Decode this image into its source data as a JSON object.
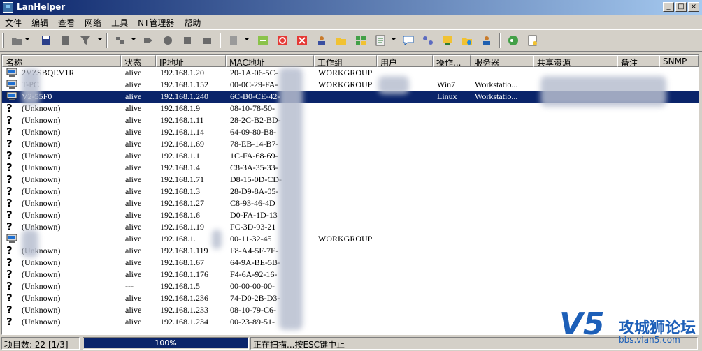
{
  "window": {
    "title": "LanHelper",
    "min": "_",
    "max": "□",
    "close": "×"
  },
  "menu": [
    "文件",
    "编辑",
    "查看",
    "网络",
    "工具",
    "NT管理器",
    "帮助"
  ],
  "columns": [
    "名称",
    "状态",
    "IP地址",
    "MAC地址",
    "工作组",
    "用户",
    "操作...",
    "服务器",
    "共享资源",
    "备注",
    "SNMP"
  ],
  "rows": [
    {
      "icon": "computer-icon",
      "name": "2VZSBQEV1R",
      "status": "alive",
      "ip": "192.168.1.20",
      "mac": "20-1A-06-5C-",
      "workgroup": "WORKGROUP",
      "user": "",
      "os": "",
      "server": "",
      "selected": false
    },
    {
      "icon": "computer-icon",
      "name": "T-PC",
      "status": "alive",
      "ip": "192.168.1.152",
      "mac": "00-0C-29-FA-",
      "workgroup": "WORKGROUP",
      "user": "",
      "os": "Win7",
      "server": "Workstatio...",
      "selected": false
    },
    {
      "icon": "computer-icon",
      "name": "V2-55F0",
      "status": "alive",
      "ip": "192.168.1.240",
      "mac": "6C-B0-CE-42-",
      "workgroup": "",
      "user": "",
      "os": "Linux",
      "server": "Workstatio...",
      "selected": true
    },
    {
      "icon": "unknown-icon",
      "name": "(Unknown)",
      "status": "alive",
      "ip": "192.168.1.9",
      "mac": "08-10-78-50-",
      "workgroup": "",
      "user": "",
      "os": "",
      "server": "",
      "selected": false
    },
    {
      "icon": "unknown-icon",
      "name": "(Unknown)",
      "status": "alive",
      "ip": "192.168.1.11",
      "mac": "28-2C-B2-BD-",
      "workgroup": "",
      "user": "",
      "os": "",
      "server": "",
      "selected": false
    },
    {
      "icon": "unknown-icon",
      "name": "(Unknown)",
      "status": "alive",
      "ip": "192.168.1.14",
      "mac": "64-09-80-B8-",
      "workgroup": "",
      "user": "",
      "os": "",
      "server": "",
      "selected": false
    },
    {
      "icon": "unknown-icon",
      "name": "(Unknown)",
      "status": "alive",
      "ip": "192.168.1.69",
      "mac": "78-EB-14-B7-",
      "workgroup": "",
      "user": "",
      "os": "",
      "server": "",
      "selected": false
    },
    {
      "icon": "unknown-icon",
      "name": "(Unknown)",
      "status": "alive",
      "ip": "192.168.1.1",
      "mac": "1C-FA-68-69-",
      "workgroup": "",
      "user": "",
      "os": "",
      "server": "",
      "selected": false
    },
    {
      "icon": "unknown-icon",
      "name": "(Unknown)",
      "status": "alive",
      "ip": "192.168.1.4",
      "mac": "C8-3A-35-33-",
      "workgroup": "",
      "user": "",
      "os": "",
      "server": "",
      "selected": false
    },
    {
      "icon": "unknown-icon",
      "name": "(Unknown)",
      "status": "alive",
      "ip": "192.168.1.71",
      "mac": "D8-15-0D-CD-",
      "workgroup": "",
      "user": "",
      "os": "",
      "server": "",
      "selected": false
    },
    {
      "icon": "unknown-icon",
      "name": "(Unknown)",
      "status": "alive",
      "ip": "192.168.1.3",
      "mac": "28-D9-8A-05-",
      "workgroup": "",
      "user": "",
      "os": "",
      "server": "",
      "selected": false
    },
    {
      "icon": "unknown-icon",
      "name": "(Unknown)",
      "status": "alive",
      "ip": "192.168.1.27",
      "mac": "C8-93-46-4D",
      "workgroup": "",
      "user": "",
      "os": "",
      "server": "",
      "selected": false
    },
    {
      "icon": "unknown-icon",
      "name": "(Unknown)",
      "status": "alive",
      "ip": "192.168.1.6",
      "mac": "D0-FA-1D-13",
      "workgroup": "",
      "user": "",
      "os": "",
      "server": "",
      "selected": false
    },
    {
      "icon": "unknown-icon",
      "name": "(Unknown)",
      "status": "alive",
      "ip": "192.168.1.19",
      "mac": "FC-3D-93-21",
      "workgroup": "",
      "user": "",
      "os": "",
      "server": "",
      "selected": false
    },
    {
      "icon": "computer-icon",
      "name": "",
      "status": "alive",
      "ip": "192.168.1.",
      "mac": "00-11-32-45",
      "workgroup": "WORKGROUP",
      "user": "",
      "os": "",
      "server": "",
      "selected": false
    },
    {
      "icon": "unknown-icon",
      "name": "(Unknown)",
      "status": "alive",
      "ip": "192.168.1.119",
      "mac": "F8-A4-5F-7E-",
      "workgroup": "",
      "user": "",
      "os": "",
      "server": "",
      "selected": false
    },
    {
      "icon": "unknown-icon",
      "name": "(Unknown)",
      "status": "alive",
      "ip": "192.168.1.67",
      "mac": "64-9A-BE-5B-",
      "workgroup": "",
      "user": "",
      "os": "",
      "server": "",
      "selected": false
    },
    {
      "icon": "unknown-icon",
      "name": "(Unknown)",
      "status": "alive",
      "ip": "192.168.1.176",
      "mac": "F4-6A-92-16-",
      "workgroup": "",
      "user": "",
      "os": "",
      "server": "",
      "selected": false
    },
    {
      "icon": "unknown-icon",
      "name": "(Unknown)",
      "status": "---",
      "ip": "192.168.1.5",
      "mac": "00-00-00-00-",
      "workgroup": "",
      "user": "",
      "os": "",
      "server": "",
      "selected": false
    },
    {
      "icon": "unknown-icon",
      "name": "(Unknown)",
      "status": "alive",
      "ip": "192.168.1.236",
      "mac": "74-D0-2B-D3-",
      "workgroup": "",
      "user": "",
      "os": "",
      "server": "",
      "selected": false
    },
    {
      "icon": "unknown-icon",
      "name": "(Unknown)",
      "status": "alive",
      "ip": "192.168.1.233",
      "mac": "08-10-79-C6-",
      "workgroup": "",
      "user": "",
      "os": "",
      "server": "",
      "selected": false
    },
    {
      "icon": "unknown-icon",
      "name": "(Unknown)",
      "status": "alive",
      "ip": "192.168.1.234",
      "mac": "00-23-89-51-",
      "workgroup": "",
      "user": "",
      "os": "",
      "server": "",
      "selected": false
    }
  ],
  "status": {
    "items": "项目数: 22 [1/3]",
    "progress": 100,
    "progress_text": "100%",
    "message": "正在扫描...按ESC键中止"
  },
  "watermark": {
    "logo": "V5",
    "name": "攻城狮论坛",
    "url": "bbs.vlan5.com"
  },
  "colors": {
    "selection": "#0a246a",
    "titlebar": "#0a246a",
    "watermark": "#1d5fb8"
  }
}
